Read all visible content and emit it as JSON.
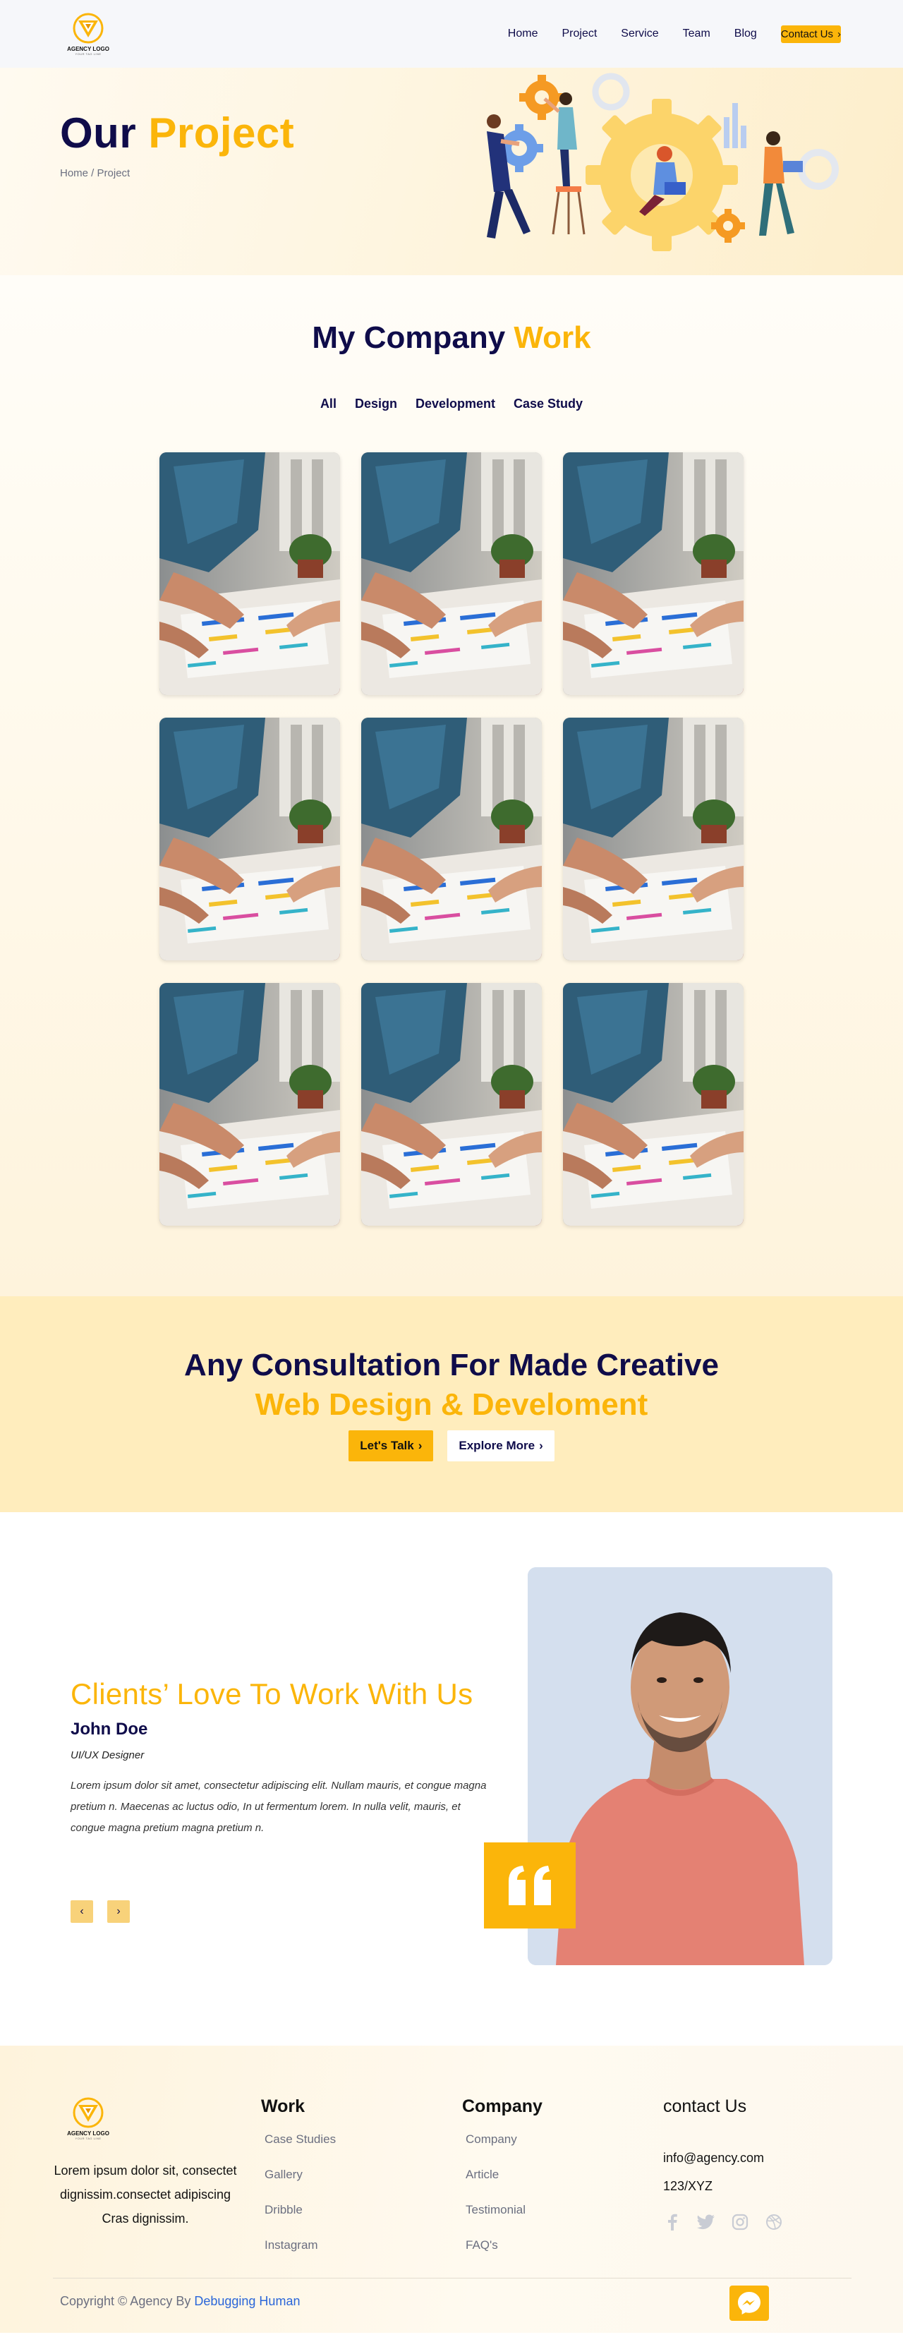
{
  "header": {
    "logo": {
      "brand": "AGENCY LOGO",
      "tagline": "YOUR TAG LINE"
    },
    "nav": [
      "Home",
      "Project",
      "Service",
      "Team",
      "Blog"
    ],
    "contact_button": "Contact Us"
  },
  "hero": {
    "title_dark": "Our ",
    "title_accent": "Project",
    "breadcrumb": "Home / Project"
  },
  "work": {
    "title_dark": "My Company ",
    "title_accent": "Work",
    "filters": [
      "All",
      "Design",
      "Development",
      "Case Study"
    ],
    "project_count": 9
  },
  "cta": {
    "line1": "Any Consultation For Made Creative",
    "line2": "Web Design & Develoment",
    "primary_button": "Let's Talk",
    "secondary_button": "Explore More"
  },
  "testimonial": {
    "title": "Clients’ Love To Work With Us",
    "name": "John Doe",
    "role": "UI/UX Designer",
    "quote": "Lorem ipsum dolor sit amet, consectetur adipiscing elit. Nullam mauris, et congue magna pretium n. Maecenas ac luctus odio, In ut fermentum lorem. In nulla velit, mauris, et congue magna pretium magna pretium n."
  },
  "footer": {
    "about": "Lorem ipsum dolor sit, consectet dignissim.consectet adipiscing Cras dignissim.",
    "work_heading": "Work",
    "work_links": [
      "Case Studies",
      "Gallery",
      "Dribble",
      "Instagram"
    ],
    "company_heading": "Company",
    "company_links": [
      "Company",
      "Article",
      "Testimonial",
      "FAQ's"
    ],
    "contact_heading": "contact Us",
    "email": "info@agency.com",
    "address": "123/XYZ",
    "socials": [
      "facebook-icon",
      "twitter-icon",
      "instagram-icon",
      "dribbble-icon"
    ],
    "copyright_prefix": "Copyright © Agency By ",
    "copyright_link": "Debugging Human"
  },
  "colors": {
    "accent": "#fbb50a",
    "navy": "#0f0c4a",
    "cta_bg": "#ffedbd"
  }
}
